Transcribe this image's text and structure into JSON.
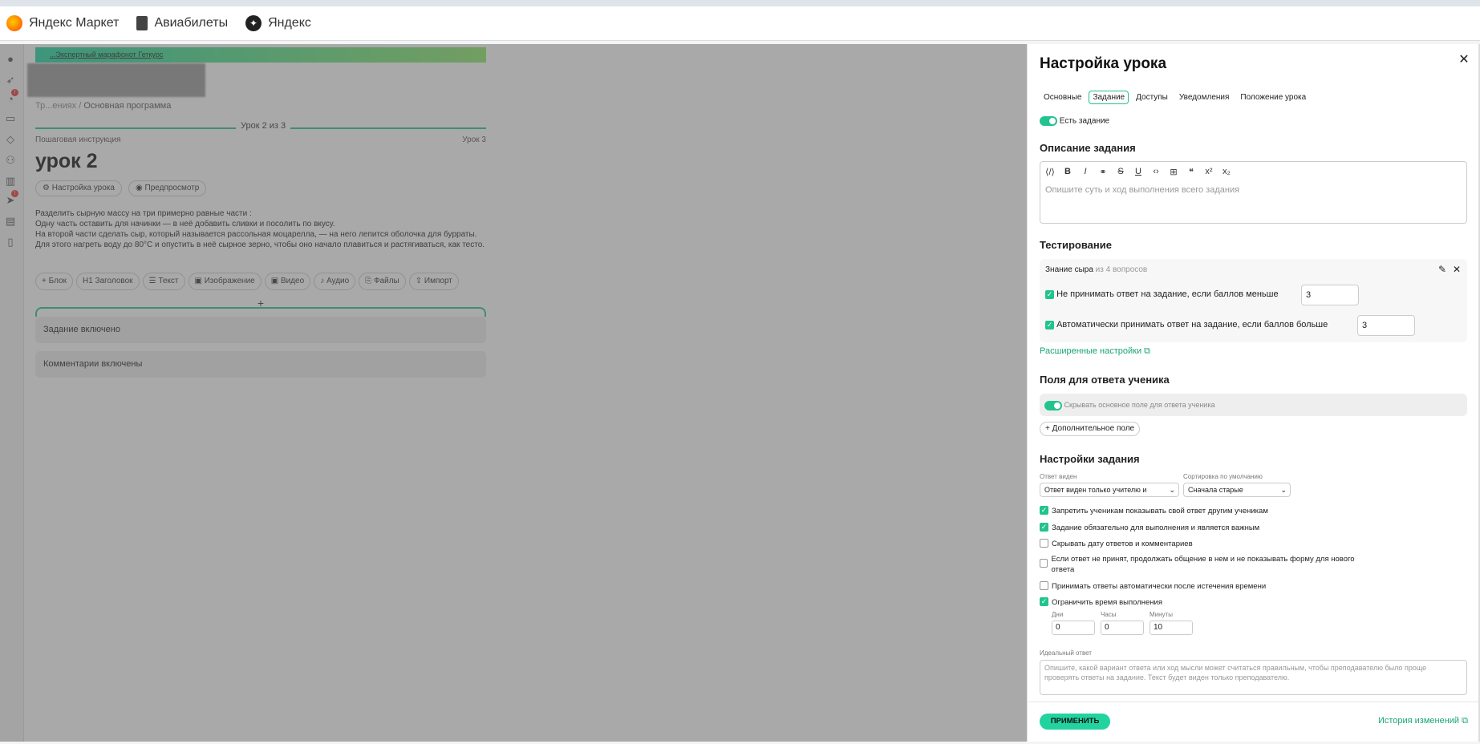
{
  "bookmarks": [
    {
      "label": "Яндекс Маркет",
      "icon": "yandex-market-icon"
    },
    {
      "label": "Авиабилеты",
      "icon": "document-icon"
    },
    {
      "label": "Яндекс",
      "icon": "yandex-icon"
    }
  ],
  "lesson": {
    "promo": "...Экспертный марафонот Геткурс",
    "breadcrumb_tail": "Основная программа",
    "step_center": "Урок 2 из 3",
    "step_left": "Пошаговая инструкция",
    "step_right": "Урок 3",
    "title": "урок 2",
    "settings_chip": "Настройка урока",
    "preview_chip": "Предпросмотр",
    "text_lines": [
      "Разделить сырную массу на три примерно равные части :",
      "Одну часть оставить для начинки — в неё добавить сливки и посолить по вкусу.",
      "На второй части сделать сыр, который называется рассольная моцарелла, — на него лепится оболочка для бурраты.",
      "Для этого нагреть воду до 80°C и опустить в неё сырное зерно, чтобы оно начало плавиться и растягиваться, как тесто."
    ],
    "blocks": [
      "Блок",
      "Заголовок",
      "Текст",
      "Изображение",
      "Видео",
      "Аудио",
      "Файлы",
      "Импорт"
    ],
    "plus": "+",
    "card_task": "Задание включено",
    "card_comments": "Комментарии включены"
  },
  "panel": {
    "title": "Настройка урока",
    "tabs": [
      "Основные",
      "Задание",
      "Доступы",
      "Уведомления",
      "Положение урока"
    ],
    "active_tab": "Задание",
    "has_task": "Есть задание",
    "desc_title": "Описание задания",
    "desc_placeholder": "Опишите суть и ход выполнения всего задания",
    "testing_title": "Тестирование",
    "test_name": "Знание сыра",
    "test_count": "из 4 вопросов",
    "reject_label": "Не принимать ответ на задание, если баллов меньше",
    "reject_value": "3",
    "accept_label": "Автоматически принимать ответ на задание, если баллов больше",
    "accept_value": "3",
    "advanced": "Расширенные настройки",
    "fields_title": "Поля для ответа ученика",
    "hide_main_field": "Скрывать основное поле для ответа ученика",
    "extra_field": "Дополнительное поле",
    "task_settings_title": "Настройки задания",
    "answer_visible_label": "Ответ виден",
    "answer_visible_value": "Ответ виден только учителю и",
    "sort_label": "Сортировка по умолчанию",
    "sort_value": "Сначала старые",
    "options": [
      {
        "label": "Запретить ученикам показывать свой ответ другим ученикам",
        "checked": true
      },
      {
        "label": "Задание обязательно для выполнения и является важным",
        "checked": true
      },
      {
        "label": "Скрывать дату ответов и комментариев",
        "checked": false
      },
      {
        "label": "Если ответ не принят, продолжать общение в нем и не показывать форму для нового ответа",
        "checked": false
      },
      {
        "label": "Принимать ответы автоматически после истечения времени",
        "checked": false
      },
      {
        "label": "Ограничить время выполнения",
        "checked": true
      }
    ],
    "time": {
      "days_label": "Дни",
      "days": "0",
      "hours_label": "Часы",
      "hours": "0",
      "minutes_label": "Минуты",
      "minutes": "10"
    },
    "ideal_label": "Идеальный ответ",
    "ideal_placeholder": "Опишите, какой вариант ответа или ход мысли может считаться правильным, чтобы преподавателю было проще проверять ответы на задание. Текст будет виден только преподавателю.",
    "apply": "ПРИМЕНИТЬ",
    "history": "История изменений"
  },
  "colors": {
    "accent": "#22c38e",
    "link": "#1aa37a"
  }
}
